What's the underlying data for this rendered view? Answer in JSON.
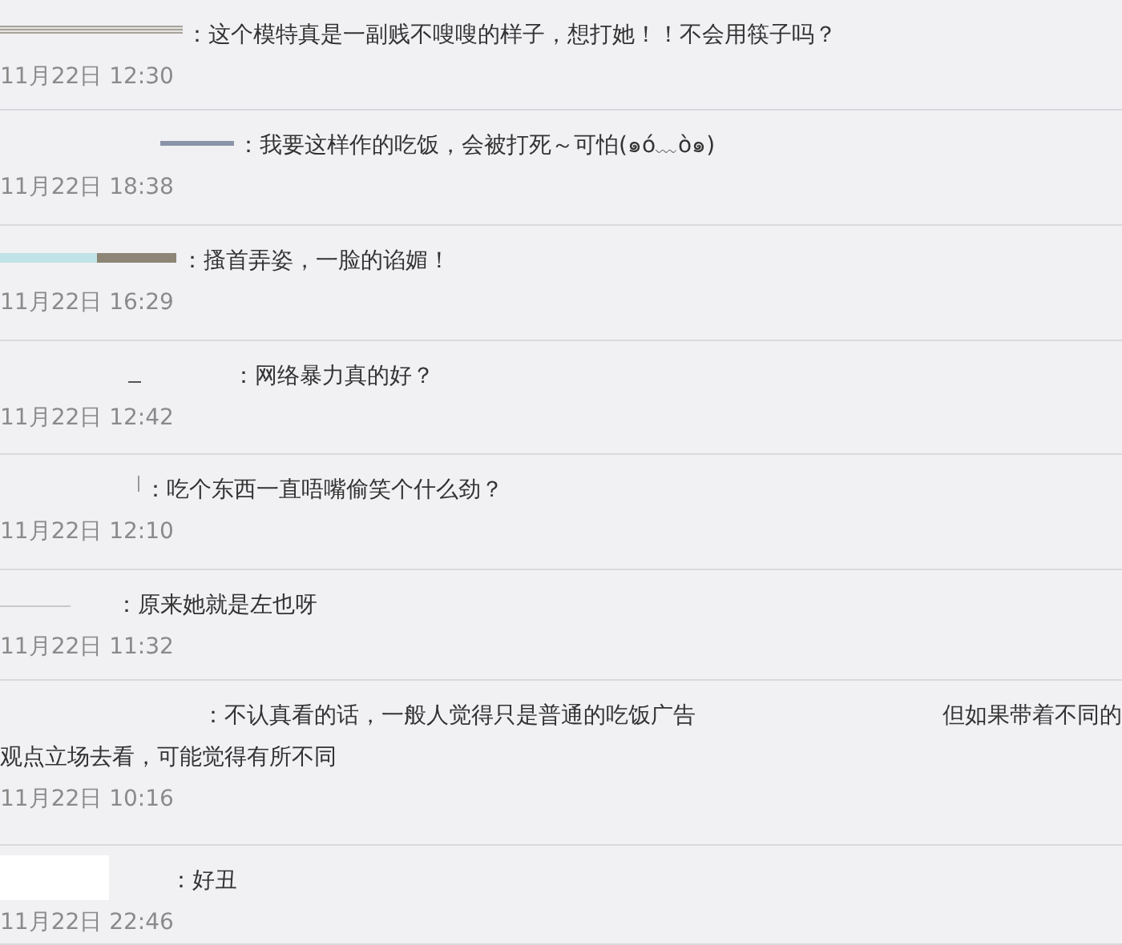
{
  "comments": [
    {
      "lines": [
        [
          "：这个模特真是一副贱不嗖嗖的样子，想打她！！不会用筷子吗？"
        ]
      ],
      "time": "11月22日 12:30"
    },
    {
      "lines": [
        [
          "：我要这样作的吃饭，会被打死～可怕(๑ó﹏ò๑)"
        ]
      ],
      "time": "11月22日 18:38"
    },
    {
      "lines": [
        [
          "：搔首弄姿，一脸的谄媚！"
        ]
      ],
      "time": "11月22日 16:29"
    },
    {
      "lines": [
        [
          "：网络暴力真的好？"
        ]
      ],
      "time": "11月22日 12:42"
    },
    {
      "lines": [
        [
          "：吃个东西一直唔嘴偷笑个什么劲？"
        ]
      ],
      "time": "11月22日 12:10"
    },
    {
      "lines": [
        [
          "：原来她就是左也呀"
        ]
      ],
      "time": "11月22日 11:32"
    },
    {
      "lines": [
        [
          "：不认真看的话，一般人觉得只是普通的吃饭广告",
          "但如果带着不同的"
        ],
        [
          "观点立场去看，可能觉得有所不同"
        ]
      ],
      "time": "11月22日 10:16"
    },
    {
      "lines": [
        [
          "：好丑"
        ]
      ],
      "time": "11月22日 22:46"
    }
  ]
}
